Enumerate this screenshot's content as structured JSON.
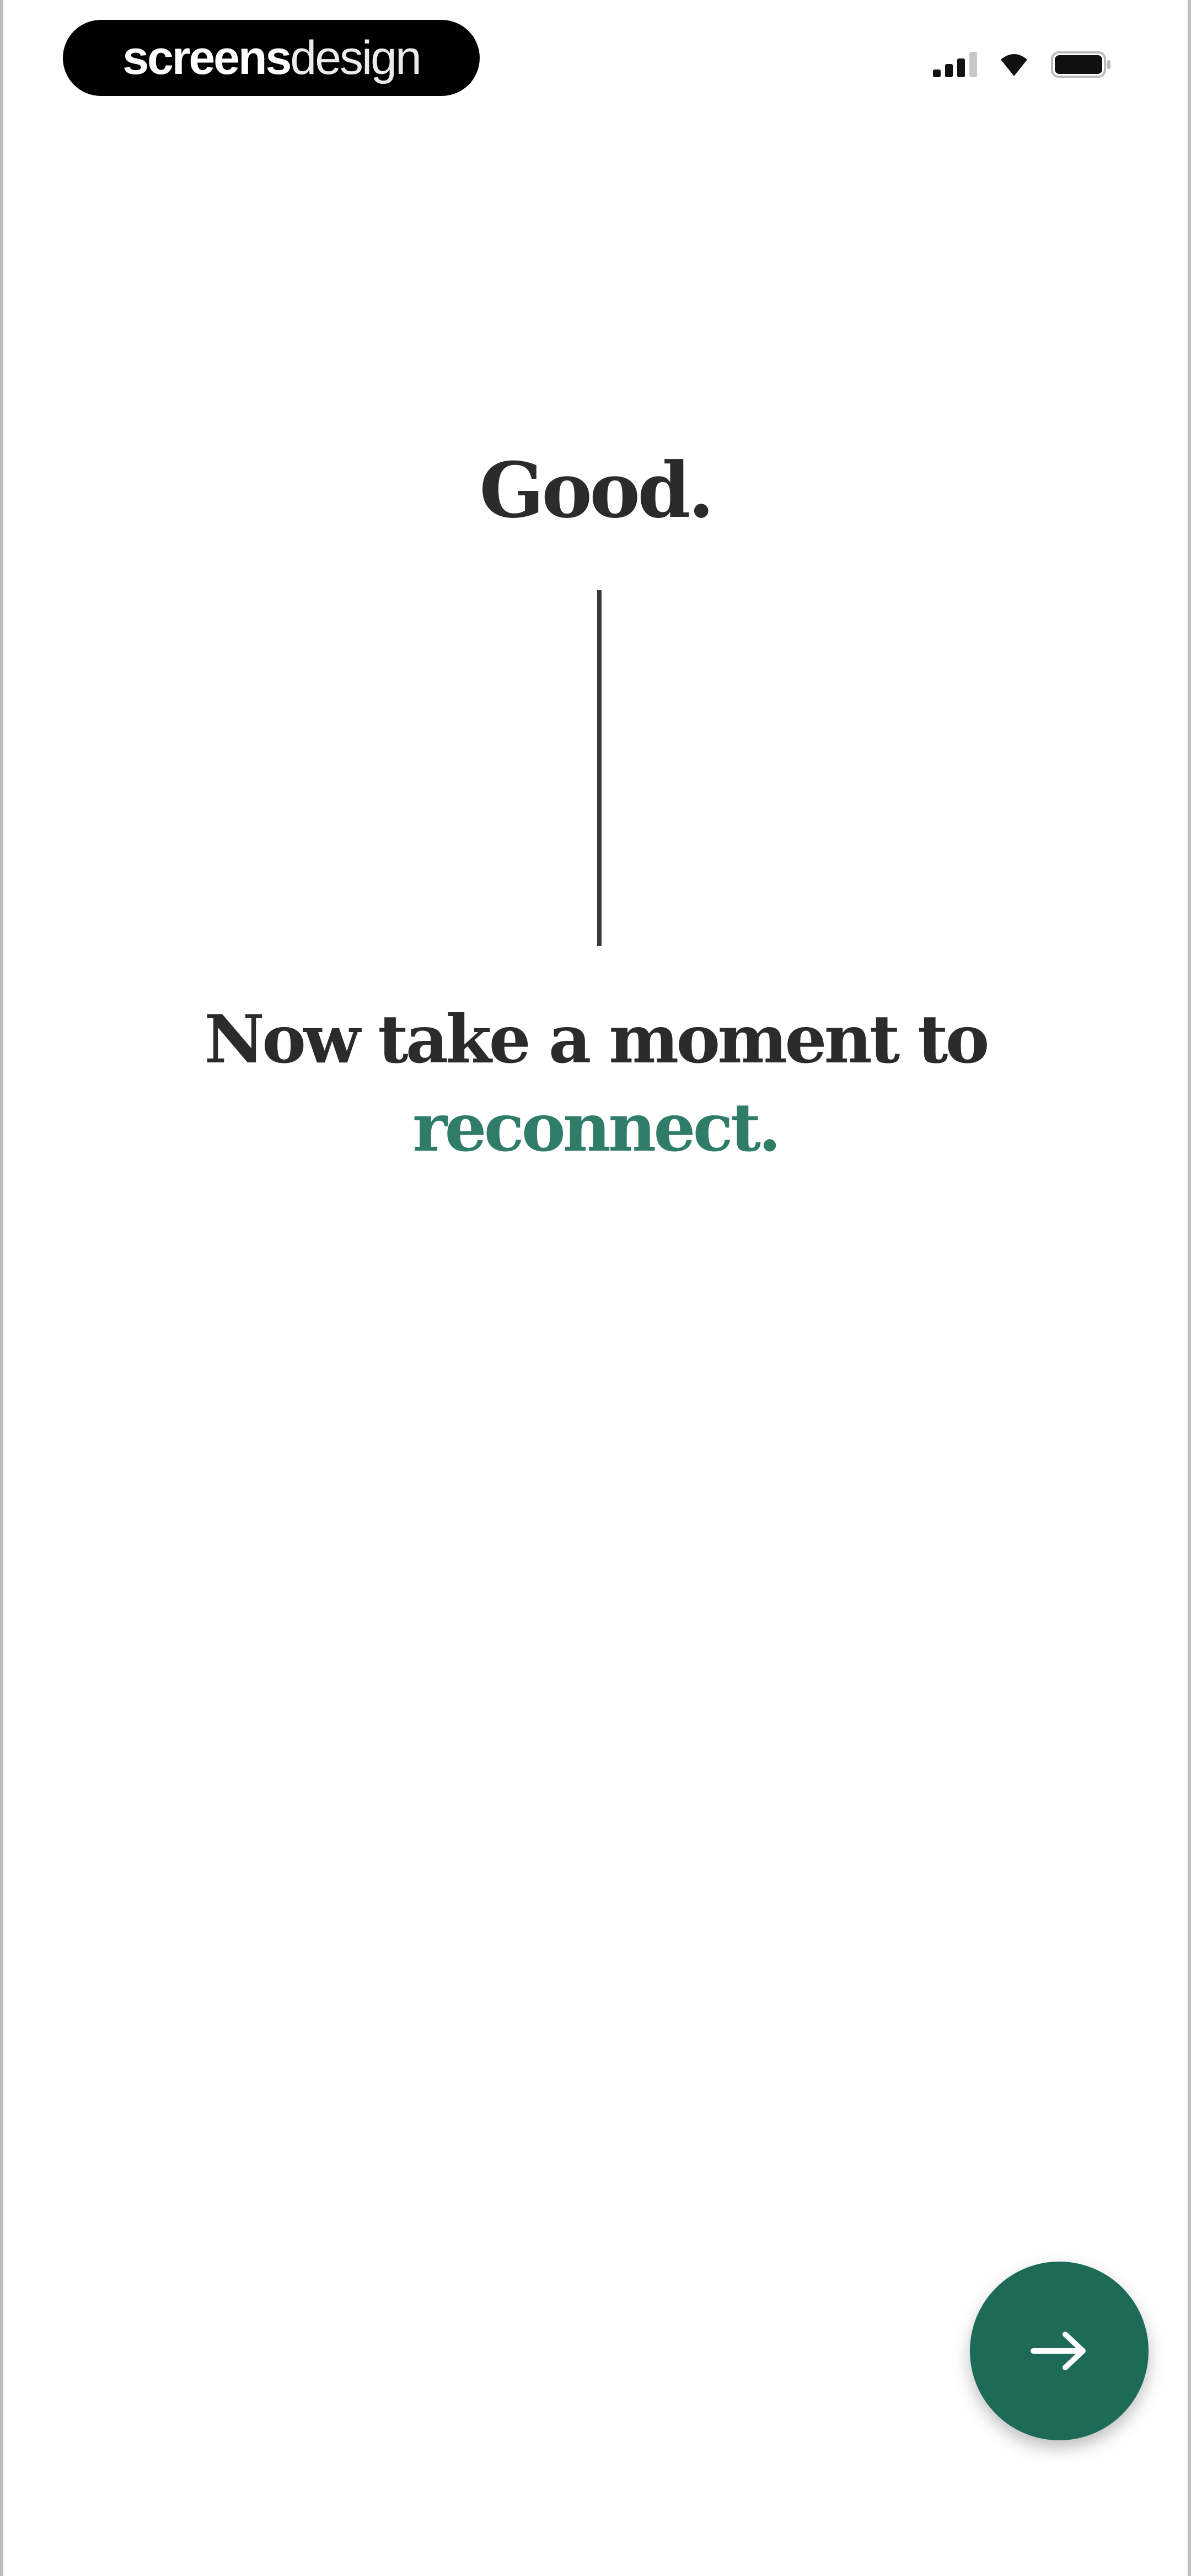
{
  "status_bar": {
    "brand": {
      "part1": "screens",
      "part2": "design"
    },
    "icons": [
      "signal-icon",
      "wifi-icon",
      "battery-icon"
    ]
  },
  "main": {
    "headline": "Good.",
    "message_lead": "Now take a moment to",
    "message_accent": "reconnect."
  },
  "next_button": {
    "icon": "arrow-right-icon"
  },
  "colors": {
    "text": "#2b2b2b",
    "accent": "#2f7d68",
    "button": "#1d6a58",
    "background": "#ffffff"
  }
}
